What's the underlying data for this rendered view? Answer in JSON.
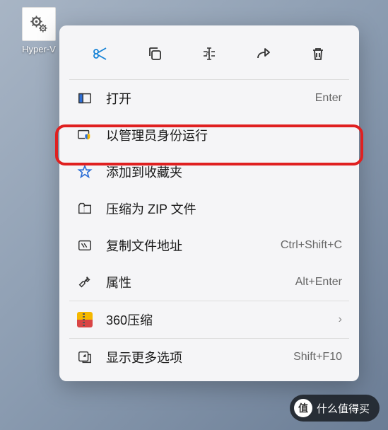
{
  "desktop": {
    "icon_label": "Hyper-V"
  },
  "toolbar": {
    "cut": "cut",
    "copy": "copy",
    "rename": "rename",
    "share": "share",
    "delete": "delete"
  },
  "menu": {
    "open": {
      "label": "打开",
      "shortcut": "Enter"
    },
    "run_admin": {
      "label": "以管理员身份运行"
    },
    "favorites": {
      "label": "添加到收藏夹"
    },
    "zip": {
      "label": "压缩为 ZIP 文件"
    },
    "copy_path": {
      "label": "复制文件地址",
      "shortcut": "Ctrl+Shift+C"
    },
    "properties": {
      "label": "属性",
      "shortcut": "Alt+Enter"
    },
    "zip360": {
      "label": "360压缩"
    },
    "more": {
      "label": "显示更多选项",
      "shortcut": "Shift+F10"
    }
  },
  "watermark": {
    "badge": "值",
    "text": "什么值得买"
  }
}
